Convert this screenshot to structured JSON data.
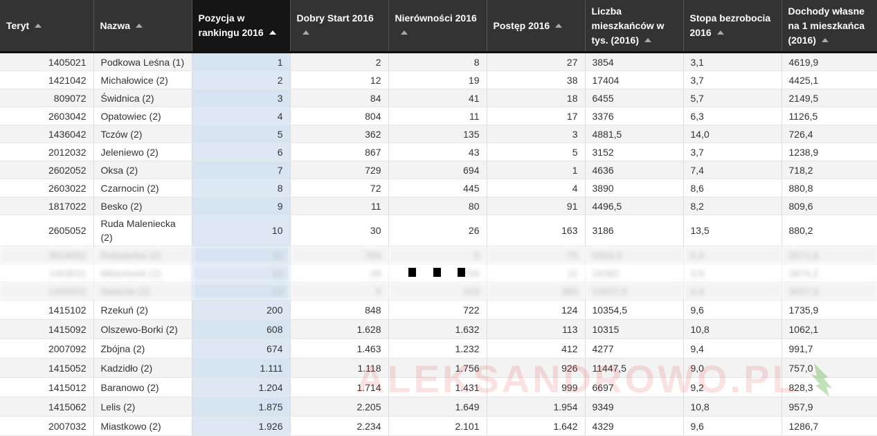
{
  "headers": [
    "Teryt",
    "Nazwa",
    "Pozycja w rankingu 2016",
    "Dobry Start 2016",
    "Nierówności 2016",
    "Postęp 2016",
    "Liczba mieszkańców w tys. (2016)",
    "Stopa bezrobocia 2016",
    "Dochody własne na 1 mieszkańca (2016)"
  ],
  "rows": [
    [
      "1405021",
      "Podkowa Leśna (1)",
      "1",
      "2",
      "8",
      "27",
      "3854",
      "3,1",
      "4619,9"
    ],
    [
      "1421042",
      "Michałowice (2)",
      "2",
      "12",
      "19",
      "38",
      "17404",
      "3,7",
      "4425,1"
    ],
    [
      "809072",
      "Świdnica (2)",
      "3",
      "84",
      "41",
      "18",
      "6455",
      "5,7",
      "2149,5"
    ],
    [
      "2603042",
      "Opatowiec (2)",
      "4",
      "804",
      "11",
      "17",
      "3376",
      "6,3",
      "1126,5"
    ],
    [
      "1436042",
      "Tczów (2)",
      "5",
      "362",
      "135",
      "3",
      "4881,5",
      "14,0",
      "726,4"
    ],
    [
      "2012032",
      "Jeleniewo (2)",
      "6",
      "867",
      "43",
      "5",
      "3152",
      "3,7",
      "1238,9"
    ],
    [
      "2602052",
      "Oksa (2)",
      "7",
      "729",
      "694",
      "1",
      "4636",
      "7,4",
      "718,2"
    ],
    [
      "2603022",
      "Czarnocin (2)",
      "8",
      "72",
      "445",
      "4",
      "3890",
      "8,6",
      "880,8"
    ],
    [
      "1817022",
      "Besko (2)",
      "9",
      "11",
      "80",
      "91",
      "4496,5",
      "8,2",
      "809,6"
    ],
    [
      "2605052",
      "Ruda Maleniecka (2)",
      "10",
      "30",
      "26",
      "163",
      "3186",
      "13,5",
      "880,2"
    ]
  ],
  "blurred_rows": [
    [
      "3014052",
      "Robylanka (2)",
      "11",
      "769",
      "5",
      "75",
      "5303,5",
      "5,4",
      "2571,8"
    ],
    [
      "1403011",
      "Milanówek (2)",
      "12",
      "28",
      "734",
      "11",
      "16362",
      "3,9",
      "2874,2"
    ],
    [
      "1432022",
      "Sadzów (2)",
      "13",
      "5",
      "103",
      "383",
      "10937,5",
      "4,4",
      "3057,9"
    ]
  ],
  "rows_after": [
    [
      "1415102",
      "Rzekuń (2)",
      "200",
      "848",
      "722",
      "124",
      "10354,5",
      "9,6",
      "1735,9"
    ],
    [
      "1415092",
      "Olszewo-Borki (2)",
      "608",
      "1.628",
      "1.632",
      "113",
      "10315",
      "10,8",
      "1062,1"
    ],
    [
      "2007092",
      "Zbójna (2)",
      "674",
      "1.463",
      "1.232",
      "412",
      "4277",
      "9,4",
      "991,7"
    ],
    [
      "1415052",
      "Kadzidło (2)",
      "1.111",
      "1.118",
      "1.756",
      "926",
      "11447,5",
      "9,0",
      "757,0"
    ],
    [
      "1415012",
      "Baranowo (2)",
      "1.204",
      "1.714",
      "1.431",
      "999",
      "6697",
      "9,2",
      "828,3"
    ],
    [
      "1415062",
      "Lelis (2)",
      "1.875",
      "2.205",
      "1.649",
      "1.954",
      "9349",
      "10,8",
      "957,9"
    ],
    [
      "2007032",
      "Miastkowo (2)",
      "1.926",
      "2.234",
      "2.101",
      "1.642",
      "4329",
      "9,6",
      "1286,7"
    ]
  ],
  "watermark": "ALEKSANDROWO.PL",
  "colors": {
    "header_bg": "#333333",
    "sorted_header_bg": "#151515",
    "sorted_col_bg": "#dde8f4",
    "watermark": "#e03c3c"
  }
}
